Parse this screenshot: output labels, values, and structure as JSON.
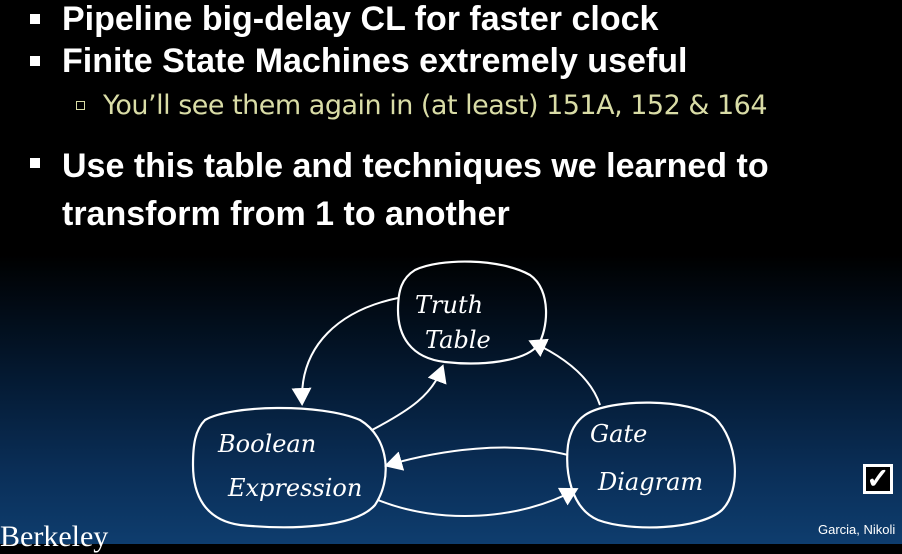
{
  "bullets": {
    "b1": "Pipeline big-delay CL for faster clock",
    "b2": "Finite State Machines extremely useful",
    "b2_sub": "You’ll see them again in (at least) 151A, 152 & 164",
    "b3": "Use this table and techniques we learned to transform from 1 to another"
  },
  "diagram": {
    "truth_table": [
      "Truth",
      "Table"
    ],
    "boolean_expression": [
      "Boolean",
      "Expression"
    ],
    "gate_diagram": [
      "Gate",
      "Diagram"
    ]
  },
  "footer": {
    "author": "Garcia, Nikoli",
    "logo": "Berkeley"
  },
  "checkbox_icon": "check-box-icon",
  "colors": {
    "background_top": "#000000",
    "background_bottom": "#0e3d6e",
    "sub_bullet_text": "#d9dca6"
  }
}
